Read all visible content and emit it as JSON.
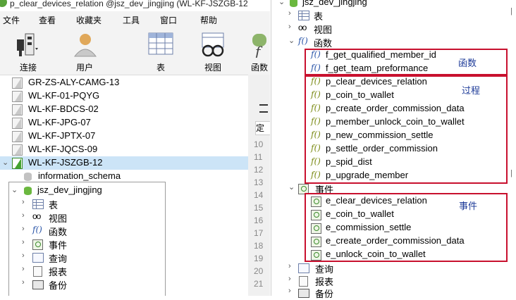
{
  "left_window": {
    "title": "p_clear_devices_relation @jsz_dev_jingjing (WL-KF-JSZGB-12",
    "menu": [
      "文件",
      "查看",
      "收藏夹",
      "工具",
      "窗口",
      "帮助"
    ],
    "toolbar": [
      "连接",
      "用户",
      "表",
      "视图",
      "函数"
    ],
    "connections": [
      "GR-ZS-ALY-CAMG-13",
      "WL-KF-01-PQYG",
      "WL-KF-BDCS-02",
      "WL-KF-JPG-07",
      "WL-KF-JPTX-07",
      "WL-KF-JQCS-09",
      "WL-KF-JSZGB-12"
    ],
    "selected_connection": "WL-KF-JSZGB-12",
    "databases": [
      "information_schema",
      "jsz_dev_jingjing"
    ],
    "tree_items": [
      "表",
      "视图",
      "函数",
      "事件",
      "查询",
      "报表",
      "备份"
    ],
    "editor_tab_fragment": "定义",
    "line_numbers": [
      "10",
      "11",
      "12",
      "13",
      "14",
      "15",
      "16",
      "17",
      "18",
      "19",
      "20",
      "21"
    ]
  },
  "right_window": {
    "db_name": "jsz_dev_jingjing",
    "categories": {
      "tables": "表",
      "views": "视图",
      "functions": "函数",
      "events": "事件",
      "queries": "查询",
      "reports": "报表",
      "backups": "备份"
    },
    "functions": [
      "f_get_qualified_member_id",
      "f_get_team_preformance"
    ],
    "procedures": [
      "p_clear_devices_relation",
      "p_coin_to_wallet",
      "p_create_order_commission_data",
      "p_member_unlock_coin_to_wallet",
      "p_new_commission_settle",
      "p_settle_order_commission",
      "p_spid_dist",
      "p_upgrade_member"
    ],
    "events": [
      "e_clear_devices_relation",
      "e_coin_to_wallet",
      "e_commission_settle",
      "e_create_order_commission_data",
      "e_unlock_coin_to_wallet"
    ],
    "annotations": {
      "functions": "函数",
      "procedures": "过程",
      "events": "事件"
    },
    "annotation_color": "#c8102e"
  },
  "icons": {
    "function": "f()",
    "glasses": "oo",
    "collapsed_arrow": "›",
    "expanded_arrow": "⌄"
  }
}
